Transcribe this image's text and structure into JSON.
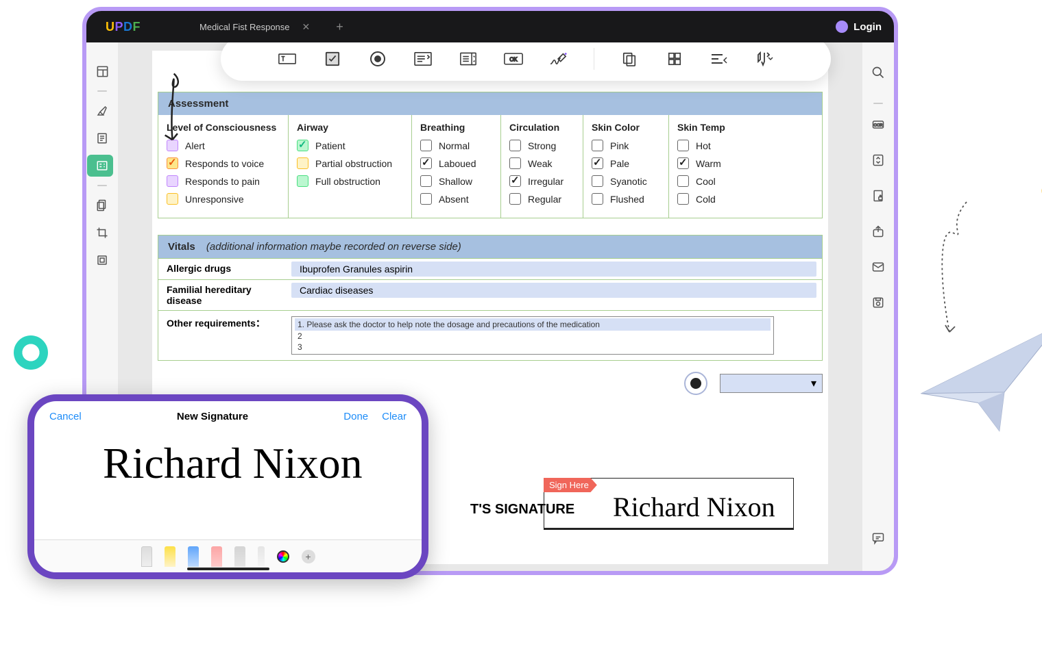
{
  "app": {
    "logo": "UPDF",
    "tab_title": "Medical Fist Response",
    "login": "Login"
  },
  "assessment": {
    "header": "Assessment",
    "cols": {
      "consciousness": {
        "title": "Level of Consciousness",
        "items": [
          {
            "label": "Alert",
            "color": "purple",
            "checked": false
          },
          {
            "label": "Responds to voice",
            "color": "orange",
            "checked": true
          },
          {
            "label": "Responds to pain",
            "color": "purple",
            "checked": false
          },
          {
            "label": "Unresponsive",
            "color": "yellow",
            "checked": false
          }
        ]
      },
      "airway": {
        "title": "Airway",
        "items": [
          {
            "label": "Patient",
            "color": "green",
            "checked": true
          },
          {
            "label": "Partial obstruction",
            "color": "yellow",
            "checked": false
          },
          {
            "label": "Full obstruction",
            "color": "green",
            "checked": false
          }
        ]
      },
      "breathing": {
        "title": "Breathing",
        "items": [
          {
            "label": "Normal",
            "checked": false
          },
          {
            "label": "Laboued",
            "checked": true
          },
          {
            "label": "Shallow",
            "checked": false
          },
          {
            "label": "Absent",
            "checked": false
          }
        ]
      },
      "circulation": {
        "title": "Circulation",
        "items": [
          {
            "label": "Strong",
            "checked": false
          },
          {
            "label": "Weak",
            "checked": false
          },
          {
            "label": "Irregular",
            "checked": true
          },
          {
            "label": "Regular",
            "checked": false
          }
        ]
      },
      "skincolor": {
        "title": "Skin Color",
        "items": [
          {
            "label": "Pink",
            "checked": false
          },
          {
            "label": "Pale",
            "checked": true
          },
          {
            "label": "Syanotic",
            "checked": false
          },
          {
            "label": "Flushed",
            "checked": false
          }
        ]
      },
      "skintemp": {
        "title": "Skin Temp",
        "items": [
          {
            "label": "Hot",
            "checked": false
          },
          {
            "label": "Warm",
            "checked": true
          },
          {
            "label": "Cool",
            "checked": false
          },
          {
            "label": "Cold",
            "checked": false
          }
        ]
      }
    }
  },
  "vitals": {
    "header_title": "Vitals",
    "header_note": "(additional information maybe recorded on reverse side)",
    "allergic_label": "Allergic drugs",
    "allergic_value": "Ibuprofen Granules  aspirin",
    "familial_label": "Familial hereditary disease",
    "familial_value": "Cardiac diseases",
    "other_label": "Other requirements：",
    "other_lines": [
      "1. Please ask the doctor to help note the dosage and precautions of the medication",
      "2",
      "3"
    ]
  },
  "signature": {
    "label": "T'S SIGNATURE",
    "sign_here": "Sign Here",
    "value": "Richard Nixon"
  },
  "phone": {
    "cancel": "Cancel",
    "title": "New Signature",
    "done": "Done",
    "clear": "Clear",
    "sig_value": "Richard Nixon"
  }
}
